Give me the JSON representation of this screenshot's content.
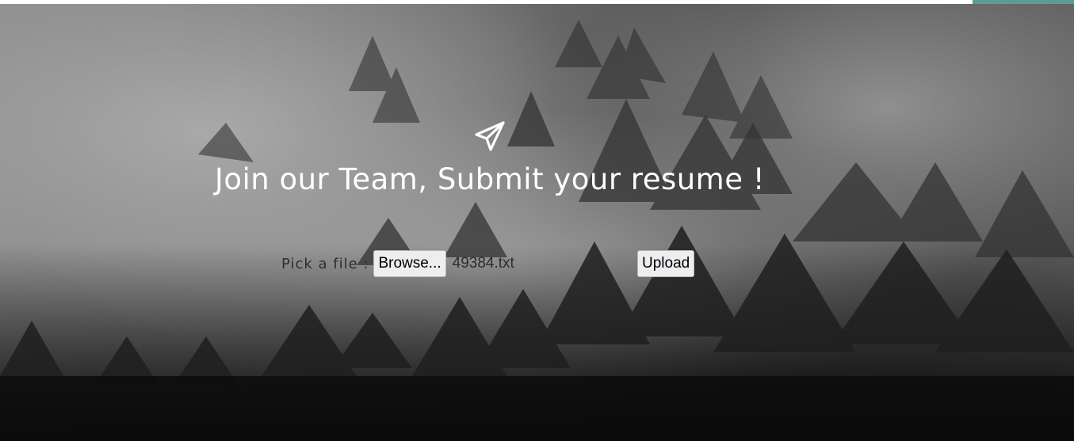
{
  "hero": {
    "icon": "paper-plane-icon",
    "headline": "Join our Team, Submit your resume !"
  },
  "upload_form": {
    "pick_label": "Pick a file :",
    "browse_label": "Browse...",
    "file_name": "49384.txt",
    "upload_label": "Upload"
  },
  "colors": {
    "top_accent": "#5f9b96",
    "headline": "#ffffff"
  }
}
